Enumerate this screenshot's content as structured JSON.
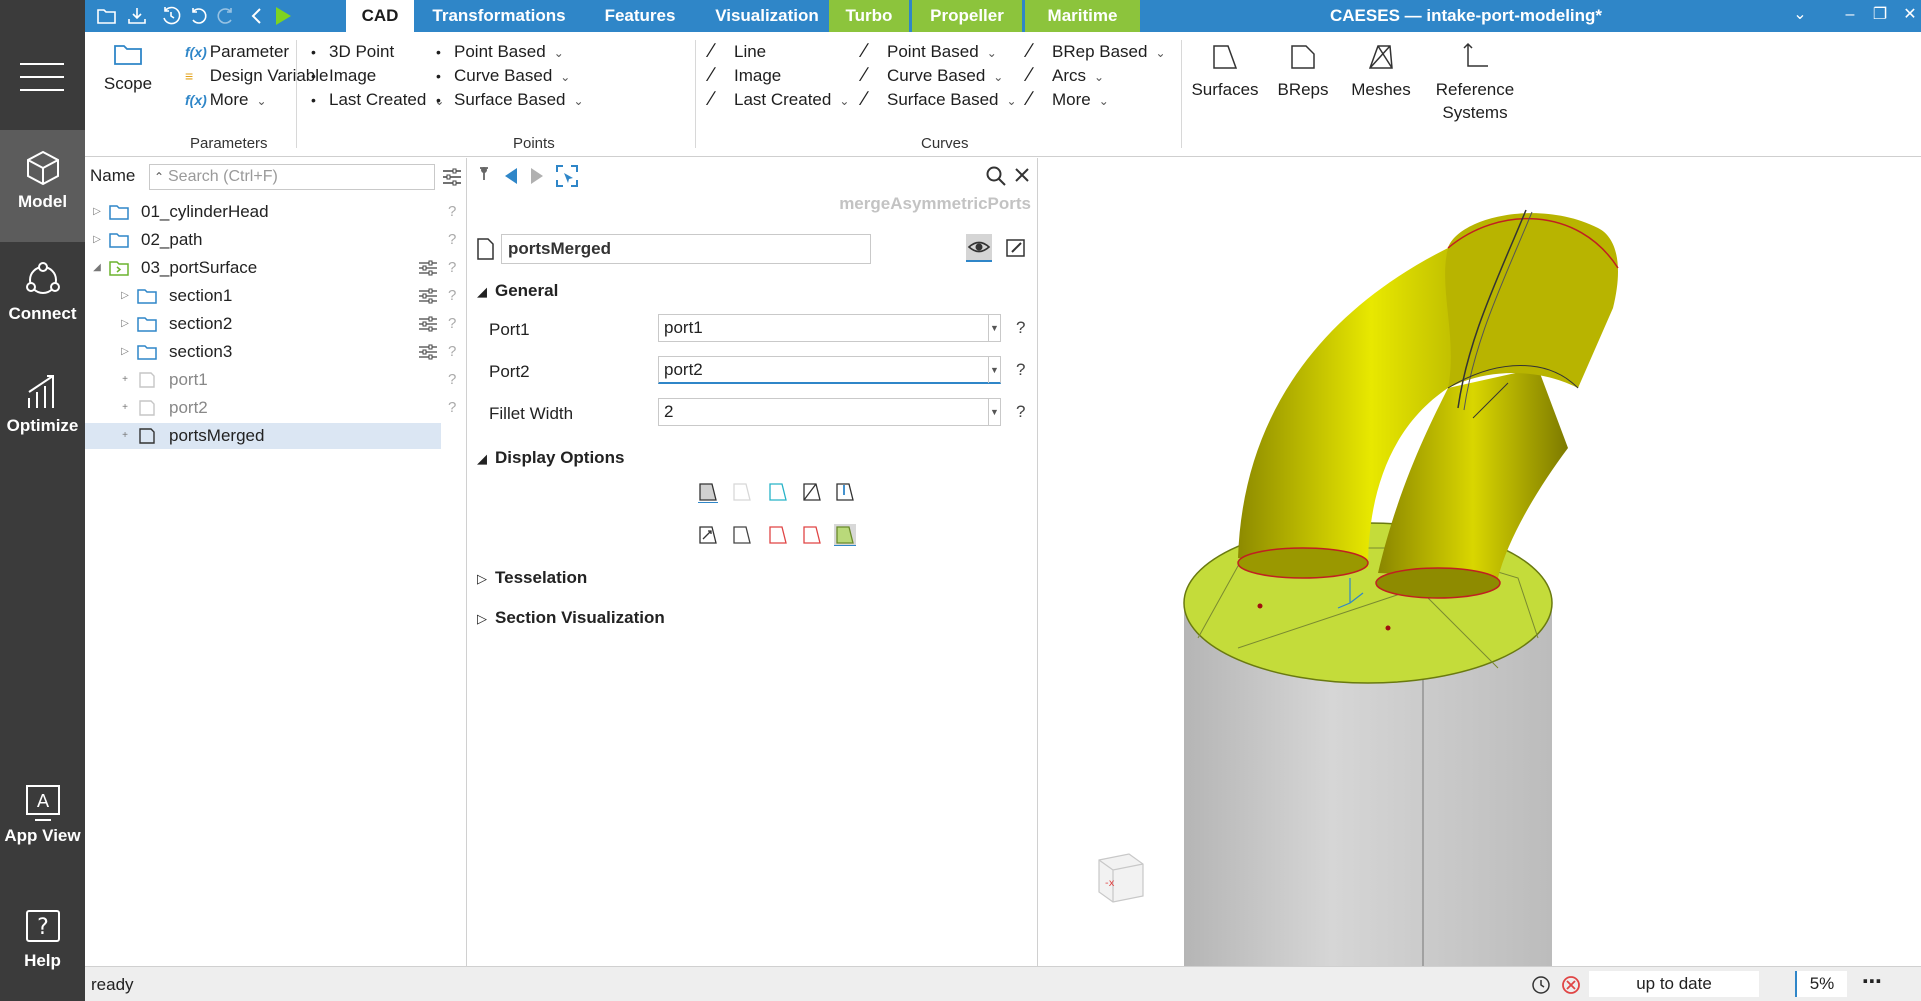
{
  "window": {
    "title": "CAESES — intake-port-modeling*"
  },
  "rail": {
    "items": [
      {
        "label": "Model",
        "icon": "cube-icon"
      },
      {
        "label": "Connect",
        "icon": "connect-icon"
      },
      {
        "label": "Optimize",
        "icon": "chart-icon"
      },
      {
        "label": "App View",
        "icon": "app-view-icon"
      },
      {
        "label": "Help",
        "icon": "help-icon"
      }
    ]
  },
  "tabs": [
    {
      "label": "CAD"
    },
    {
      "label": "Transformations"
    },
    {
      "label": "Features"
    },
    {
      "label": "Visualization"
    },
    {
      "label": "Turbo"
    },
    {
      "label": "Propeller"
    },
    {
      "label": "Maritime"
    }
  ],
  "ribbon": {
    "scope": "Scope",
    "parameters": {
      "items": [
        "Parameter",
        "Design Variable",
        "More"
      ],
      "group": "Parameters"
    },
    "points": {
      "col1": [
        "3D Point",
        "Image",
        "Last Created"
      ],
      "col2": [
        "Point Based",
        "Curve Based",
        "Surface Based"
      ],
      "group": "Points"
    },
    "curves": {
      "col1": [
        "Line",
        "Image",
        "Last Created"
      ],
      "col2": [
        "Point Based",
        "Curve Based",
        "Surface Based"
      ],
      "col3": [
        "BRep Based",
        "Arcs",
        "More"
      ],
      "group": "Curves"
    },
    "big": [
      "Surfaces",
      "BReps",
      "Meshes",
      "Reference Systems"
    ]
  },
  "tree": {
    "header": "Name",
    "search_placeholder": "Search (Ctrl+F)",
    "rows": [
      {
        "label": "01_cylinderHead"
      },
      {
        "label": "02_path"
      },
      {
        "label": "03_portSurface"
      },
      {
        "label": "section1"
      },
      {
        "label": "section2"
      },
      {
        "label": "section3"
      },
      {
        "label": "port1"
      },
      {
        "label": "port2"
      },
      {
        "label": "portsMerged"
      }
    ]
  },
  "props": {
    "type_title": "mergeAsymmetricPorts",
    "name": "portsMerged",
    "general": "General",
    "fields": [
      {
        "label": "Port1",
        "value": "port1"
      },
      {
        "label": "Port2",
        "value": "port2"
      },
      {
        "label": "Fillet Width",
        "value": "2"
      }
    ],
    "help": "?",
    "display_options": "Display Options",
    "tesselation": "Tesselation",
    "section_visualization": "Section Visualization"
  },
  "status": {
    "left": "ready",
    "state": "up to date",
    "zoom": "5%"
  },
  "colors": {
    "accent": "#2f86c8",
    "green": "#8cc43c",
    "rail": "#3b3b3b",
    "surface": "#c8c800"
  }
}
